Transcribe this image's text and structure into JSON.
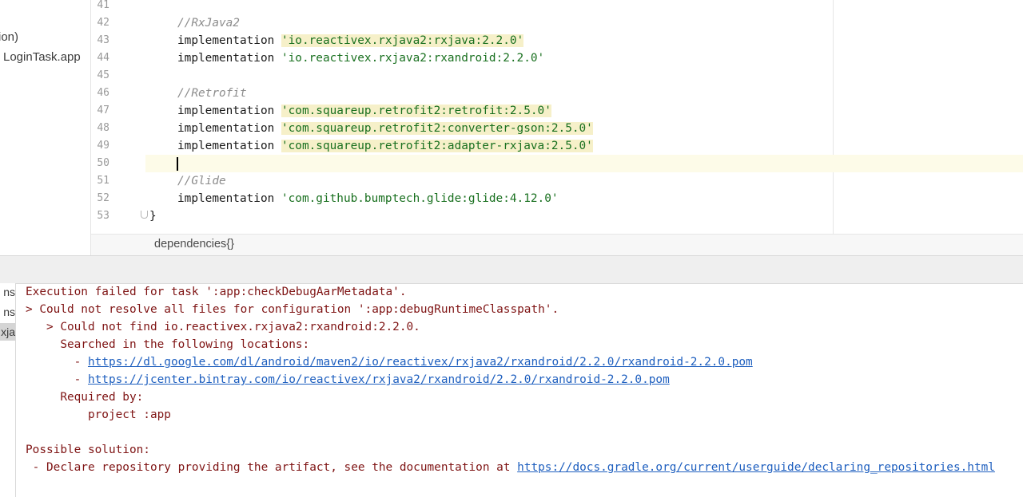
{
  "project_panel": {
    "items": [
      "ion)",
      "LoginTask.app"
    ]
  },
  "editor": {
    "line_numbers": [
      "41",
      "42",
      "43",
      "44",
      "45",
      "46",
      "47",
      "48",
      "49",
      "50",
      "51",
      "52",
      "53"
    ],
    "lines": [
      {
        "text": ""
      },
      {
        "comment": "//RxJava2"
      },
      {
        "prefix": "implementation ",
        "string": "'io.reactivex.rxjava2:rxjava:2.2.0'",
        "highlight": true
      },
      {
        "prefix": "implementation ",
        "string": "'io.reactivex.rxjava2:rxandroid:2.2.0'",
        "highlight": false
      },
      {
        "text": ""
      },
      {
        "comment": "//Retrofit"
      },
      {
        "prefix": "implementation ",
        "string": "'com.squareup.retrofit2:retrofit:2.5.0'",
        "highlight": true
      },
      {
        "prefix": "implementation ",
        "string": "'com.squareup.retrofit2:converter-gson:2.5.0'",
        "highlight": true
      },
      {
        "prefix": "implementation ",
        "string": "'com.squareup.retrofit2:adapter-rxjava:2.5.0'",
        "highlight": true
      },
      {
        "text": "",
        "current": true
      },
      {
        "comment": "//Glide"
      },
      {
        "prefix": "implementation ",
        "string": "'com.github.bumptech.glide:glide:4.12.0'",
        "highlight": false
      },
      {
        "brace": "}"
      }
    ],
    "breadcrumb": "dependencies{}"
  },
  "build_tree": {
    "items": [
      "ns",
      "ns",
      "xja"
    ]
  },
  "build_output": {
    "line1": "Execution failed for task ':app:checkDebugAarMetadata'.",
    "line2": "> Could not resolve all files for configuration ':app:debugRuntimeClasspath'.",
    "line3": "   > Could not find io.reactivex.rxjava2:rxandroid:2.2.0.",
    "line4": "     Searched in the following locations:",
    "line5_prefix": "       - ",
    "line5_link": "https://dl.google.com/dl/android/maven2/io/reactivex/rxjava2/rxandroid/2.2.0/rxandroid-2.2.0.pom",
    "line6_prefix": "       - ",
    "line6_link": "https://jcenter.bintray.com/io/reactivex/rxjava2/rxandroid/2.2.0/rxandroid-2.2.0.pom",
    "line7": "     Required by:",
    "line8": "         project :app",
    "line9": "Possible solution:",
    "line10_prefix": " - Declare repository providing the artifact, see the documentation at ",
    "line10_link": "https://docs.gradle.org/current/userguide/declaring_repositories.html"
  }
}
